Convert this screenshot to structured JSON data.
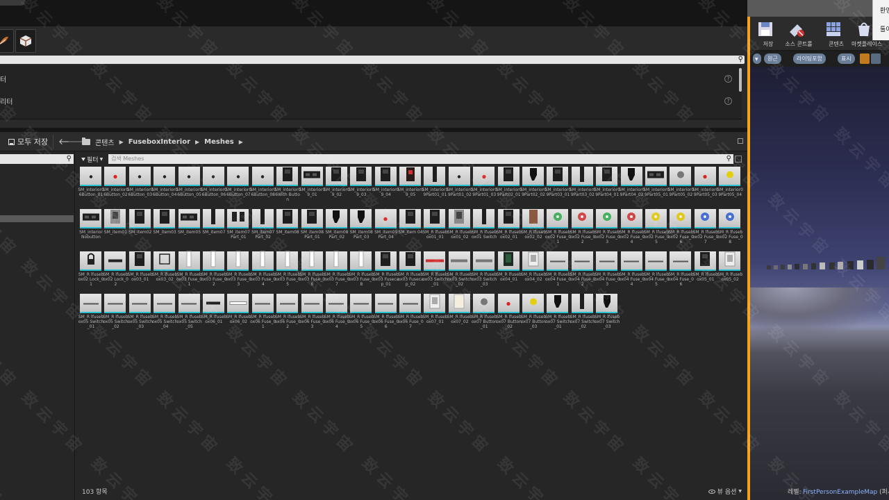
{
  "save_all_label": "모두 저장",
  "breadcrumb": [
    "콘텐츠",
    "FuseboxInterior",
    "Meshes"
  ],
  "filter_label": "필터",
  "search_placeholder": "검색 Meshes",
  "details_rows": [
    "터",
    "리터"
  ],
  "status_count": "103 항목",
  "view_options_label": "뷰 옵션",
  "toolbar_buttons": [
    "저장",
    "소스 콘트롤",
    "콘텐츠",
    "마켓플레이스"
  ],
  "viewport_pills": [
    "원근",
    "라이팅포함",
    "표시"
  ],
  "level_label": "레벨:",
  "level_name": "FirstPersonExampleMap",
  "level_suffix": "(퍼시스턴트)",
  "tooltip_lines": [
    "환영",
    "툴이"
  ],
  "accent_color": "#2bc0cf",
  "highlight_color": "#f6a21a",
  "assets": [
    {
      "name": "SM_interior06Button_01",
      "icon": "button-dark"
    },
    {
      "name": "SM_interior06Button_02",
      "icon": "button-red"
    },
    {
      "name": "SM_interior06Button_03",
      "icon": "button-dark"
    },
    {
      "name": "SM_interior06Button_04",
      "icon": "button-dark"
    },
    {
      "name": "SM_interior06Button_05",
      "icon": "button-dark"
    },
    {
      "name": "SM_interior06Button_06",
      "icon": "button-dark"
    },
    {
      "name": "SM_interior06Button_07",
      "icon": "button-dark"
    },
    {
      "name": "SM_interior06Button_08",
      "icon": "button-dark"
    },
    {
      "name": "SM_interior06With Button",
      "icon": "box-dark"
    },
    {
      "name": "SM_interior09_01",
      "icon": "wide-dark"
    },
    {
      "name": "SM_interior09_02",
      "icon": "box-dark"
    },
    {
      "name": "SM_interior09_03",
      "icon": "box-dark"
    },
    {
      "name": "SM_interior09_04",
      "icon": "box-dark"
    },
    {
      "name": "SM_interior09_05",
      "icon": "box-red"
    },
    {
      "name": "SM_interior09Part01_01",
      "icon": "tall-dark"
    },
    {
      "name": "SM_interior09Part01_02",
      "icon": "button-dark"
    },
    {
      "name": "SM_interior09Part01_03",
      "icon": "button-red"
    },
    {
      "name": "SM_interior09Part02_01",
      "icon": "box-dark"
    },
    {
      "name": "SM_interior09Part02_02",
      "icon": "knob-dark"
    },
    {
      "name": "SM_interior09Part03_01",
      "icon": "box-dark"
    },
    {
      "name": "SM_interior09Part03_02",
      "icon": "tall-dark"
    },
    {
      "name": "SM_interior09Part04_01",
      "icon": "box-dark"
    },
    {
      "name": "SM_interior09Part04_02",
      "icon": "knob-dark"
    },
    {
      "name": "SM_interior09Part05_01",
      "icon": "wide-dark"
    },
    {
      "name": "SM_interior09Part05_02",
      "icon": "button-grey"
    },
    {
      "name": "SM_interior09Part05_03",
      "icon": "button-red"
    },
    {
      "name": "SM_interior09Part05_04",
      "icon": "button-yellow"
    },
    {
      "name": "SM_interior Nobutton",
      "icon": "wide-dark"
    },
    {
      "name": "SM_item01",
      "icon": "box-grey"
    },
    {
      "name": "SM_item02",
      "icon": "box-dark"
    },
    {
      "name": "SM_item03",
      "icon": "box-dark"
    },
    {
      "name": "SM_item05",
      "icon": "wide-dark"
    },
    {
      "name": "SM_item07",
      "icon": "tall-dark"
    },
    {
      "name": "SM_item07 Part_01",
      "icon": "pair-dark"
    },
    {
      "name": "SM_item07 Part_02",
      "icon": "tall-dark"
    },
    {
      "name": "SM_item08",
      "icon": "box-dark"
    },
    {
      "name": "SM_item08 Part_01",
      "icon": "box-dark"
    },
    {
      "name": "SM_item08 Part_02",
      "icon": "knob-dark"
    },
    {
      "name": "SM_item08 Part_03",
      "icon": "knob-dark"
    },
    {
      "name": "SM_item09 Part_04",
      "icon": "button-red"
    },
    {
      "name": "SM_item 04",
      "icon": "box-dark"
    },
    {
      "name": "SM_R lfusebox01_01",
      "icon": "box-dark"
    },
    {
      "name": "SM_R lfusebox01_02",
      "icon": "box-grey"
    },
    {
      "name": "SM_R lfusebox01 Switch",
      "icon": "tall-dark"
    },
    {
      "name": "SM_R lfusebox02_01",
      "icon": "box-dark"
    },
    {
      "name": "SM_R lfusebox02_02",
      "icon": "box-brown"
    },
    {
      "name": "SM_R lfusebox02 Fuse_01",
      "icon": "fuse-green"
    },
    {
      "name": "SM_R lfusebox02 Fuse_02",
      "icon": "fuse-red"
    },
    {
      "name": "SM_R lfusebox02 Fuse_03",
      "icon": "fuse-green"
    },
    {
      "name": "SM_R lfusebox02 Fuse_04",
      "icon": "fuse-red"
    },
    {
      "name": "SM_R lfusebox02 Fuse_05",
      "icon": "fuse-yellow"
    },
    {
      "name": "SM_R lfusebox02 Fuse_06",
      "icon": "fuse-yellow"
    },
    {
      "name": "SM_R lfusebox02 Fuse_07",
      "icon": "fuse-blue"
    },
    {
      "name": "SM_R lfusebox02 Fuse_08",
      "icon": "fuse-blue"
    },
    {
      "name": "SM_R lfusebox02 Lock_01",
      "icon": "lock-dark"
    },
    {
      "name": "SM_R lfusebox02 Lock_02",
      "icon": "bar-dark"
    },
    {
      "name": "SM_R lfusebox03_01",
      "icon": "box-dark"
    },
    {
      "name": "SM_R lfusebox03_02",
      "icon": "frame-dark"
    },
    {
      "name": "SM_R lfusebox03 Fuse_01",
      "icon": "cyl-white"
    },
    {
      "name": "SM_R lfusebox03 Fuse_02",
      "icon": "cyl-white"
    },
    {
      "name": "SM_R lfusebox03 Fuse_03",
      "icon": "cyl-white"
    },
    {
      "name": "SM_R lfusebox03 Fuse_04",
      "icon": "cyl-white"
    },
    {
      "name": "SM_R lfusebox03 Fuse_05",
      "icon": "cyl-white"
    },
    {
      "name": "SM_R lfusebox03 Fuse_06",
      "icon": "cyl-white"
    },
    {
      "name": "SM_R lfusebox03 Fuse_07",
      "icon": "cyl-white"
    },
    {
      "name": "SM_R lfusebox03 Fuse_08",
      "icon": "cyl-white"
    },
    {
      "name": "SM_R lfusebox03 Fusecap_01",
      "icon": "box-dark"
    },
    {
      "name": "SM_R lfusebox03 Fusecap_02",
      "icon": "box-dark"
    },
    {
      "name": "SM_R lfusebox03 Switch_01",
      "icon": "bar-red"
    },
    {
      "name": "SM_R lfusebox03 Switch_02",
      "icon": "bar-grey"
    },
    {
      "name": "SM_R lfusebox03 Switch_03",
      "icon": "bar-grey"
    },
    {
      "name": "SM_R lfusebox04_01",
      "icon": "box-green"
    },
    {
      "name": "SM_R lfusebox04_02",
      "icon": "box-white"
    },
    {
      "name": "SM_R lfusebox04 Fuse_01",
      "icon": "line-grey"
    },
    {
      "name": "SM_R lfusebox04 Fuse_02",
      "icon": "line-grey"
    },
    {
      "name": "SM_R lfusebox04 Fuse_03",
      "icon": "line-grey"
    },
    {
      "name": "SM_R lfusebox04 Fuse_04",
      "icon": "line-grey"
    },
    {
      "name": "SM_R lfusebox04 Fuse_05",
      "icon": "line-grey"
    },
    {
      "name": "SM_R lfusebox04 Fuse_06",
      "icon": "line-grey"
    },
    {
      "name": "SM_R lfusebox05_01",
      "icon": "box-dark"
    },
    {
      "name": "SM_R lfusebox05_02",
      "icon": "box-white"
    },
    {
      "name": "SM_R lfusebox05 Switch_01",
      "icon": "line-grey"
    },
    {
      "name": "SM_R lfusebox05 Switch_02",
      "icon": "line-grey"
    },
    {
      "name": "SM_R lfusebox05 Switch_03",
      "icon": "line-grey"
    },
    {
      "name": "SM_R lfusebox05 Switch_04",
      "icon": "line-grey"
    },
    {
      "name": "SM_R lfusebox05 Switch_05",
      "icon": "line-grey"
    },
    {
      "name": "SM_R lfusebox06_01",
      "icon": "bar-dark"
    },
    {
      "name": "SM_R lfusebox06_02",
      "icon": "bar-white"
    },
    {
      "name": "SM_R lfusebox06 Fuse_01",
      "icon": "line-grey"
    },
    {
      "name": "SM_R lfusebox06 Fuse_02",
      "icon": "line-grey"
    },
    {
      "name": "SM_R lfusebox06 Fuse_03",
      "icon": "line-grey"
    },
    {
      "name": "SM_R lfusebox06 Fuse_04",
      "icon": "line-grey"
    },
    {
      "name": "SM_R lfusebox06 Fuse_05",
      "icon": "line-grey"
    },
    {
      "name": "SM_R lfusebox06 Fuse_06",
      "icon": "line-grey"
    },
    {
      "name": "SM_R lfusebox06 Fuse_07",
      "icon": "line-grey"
    },
    {
      "name": "SM_R lfusebox07_01",
      "icon": "box-white"
    },
    {
      "name": "SM_R lfusebox07_02",
      "icon": "box-cream"
    },
    {
      "name": "SM_R lfusebox07 Button_01",
      "icon": "button-grey"
    },
    {
      "name": "SM_R lfusebox07 Button_02",
      "icon": "button-red"
    },
    {
      "name": "SM_R lfusebox07 Button_03",
      "icon": "button-yellow"
    },
    {
      "name": "SM_R lfusebox07 Switch_01",
      "icon": "knob-dark"
    },
    {
      "name": "SM_R lfusebox07 Switch_02",
      "icon": "tall-dark"
    },
    {
      "name": "SM_R lfusebox07 Switch_03",
      "icon": "knob-dark"
    }
  ]
}
